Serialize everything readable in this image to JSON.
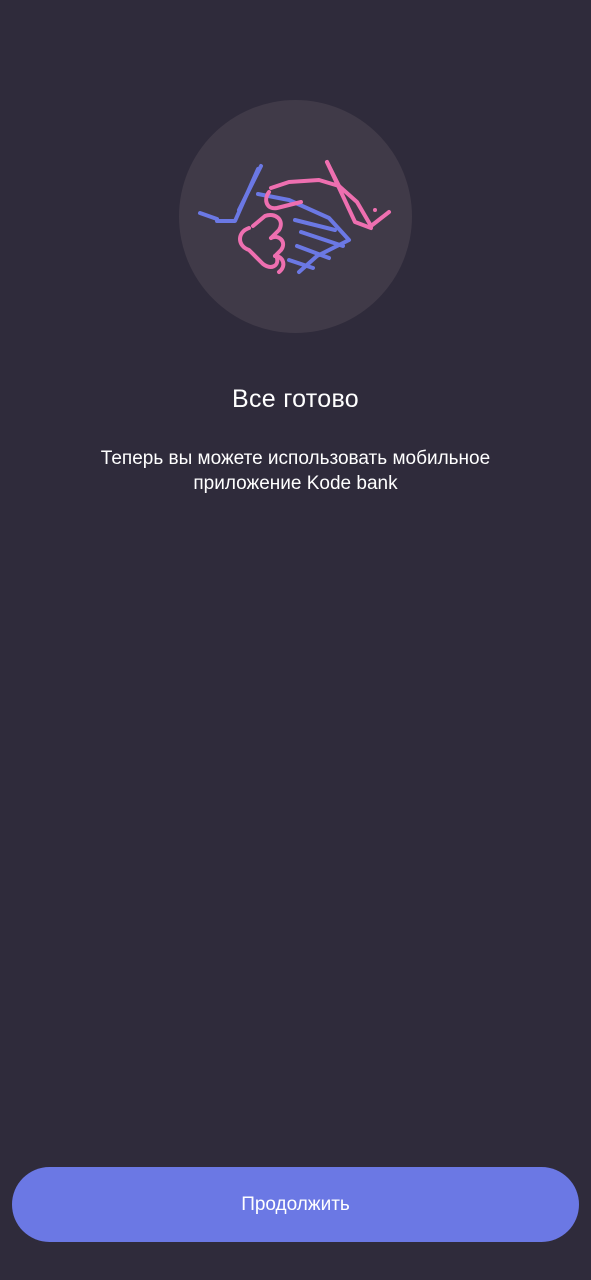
{
  "screen": {
    "illustration_icon": "handshake-icon",
    "title": "Все готово",
    "subtitle": "Теперь вы можете использовать мобильное приложение Kode bank",
    "continue_label": "Продолжить"
  },
  "colors": {
    "background": "#2f2b3b",
    "illustration_circle": "#403a48",
    "accent_blue": "#6b78e4",
    "accent_pink": "#ee6fb0",
    "text": "#ffffff"
  }
}
